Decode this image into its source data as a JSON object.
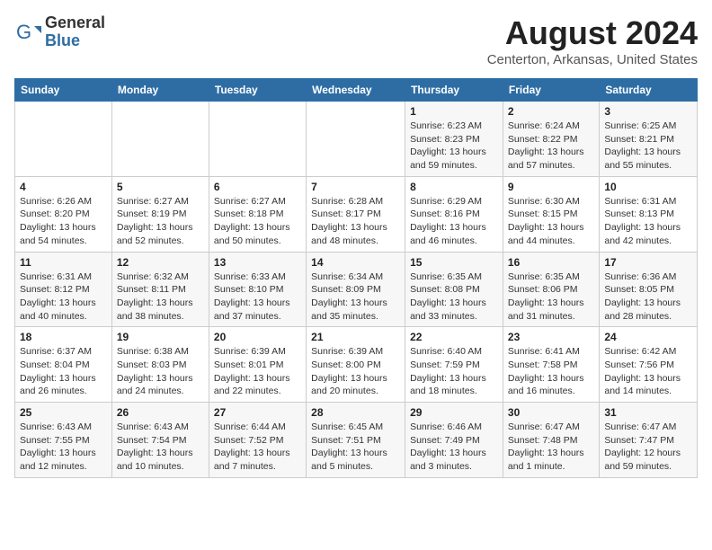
{
  "header": {
    "logo_general": "General",
    "logo_blue": "Blue",
    "title": "August 2024",
    "subtitle": "Centerton, Arkansas, United States"
  },
  "days_of_week": [
    "Sunday",
    "Monday",
    "Tuesday",
    "Wednesday",
    "Thursday",
    "Friday",
    "Saturday"
  ],
  "weeks": [
    [
      {
        "day": "",
        "info": ""
      },
      {
        "day": "",
        "info": ""
      },
      {
        "day": "",
        "info": ""
      },
      {
        "day": "",
        "info": ""
      },
      {
        "day": "1",
        "info": "Sunrise: 6:23 AM\nSunset: 8:23 PM\nDaylight: 13 hours\nand 59 minutes."
      },
      {
        "day": "2",
        "info": "Sunrise: 6:24 AM\nSunset: 8:22 PM\nDaylight: 13 hours\nand 57 minutes."
      },
      {
        "day": "3",
        "info": "Sunrise: 6:25 AM\nSunset: 8:21 PM\nDaylight: 13 hours\nand 55 minutes."
      }
    ],
    [
      {
        "day": "4",
        "info": "Sunrise: 6:26 AM\nSunset: 8:20 PM\nDaylight: 13 hours\nand 54 minutes."
      },
      {
        "day": "5",
        "info": "Sunrise: 6:27 AM\nSunset: 8:19 PM\nDaylight: 13 hours\nand 52 minutes."
      },
      {
        "day": "6",
        "info": "Sunrise: 6:27 AM\nSunset: 8:18 PM\nDaylight: 13 hours\nand 50 minutes."
      },
      {
        "day": "7",
        "info": "Sunrise: 6:28 AM\nSunset: 8:17 PM\nDaylight: 13 hours\nand 48 minutes."
      },
      {
        "day": "8",
        "info": "Sunrise: 6:29 AM\nSunset: 8:16 PM\nDaylight: 13 hours\nand 46 minutes."
      },
      {
        "day": "9",
        "info": "Sunrise: 6:30 AM\nSunset: 8:15 PM\nDaylight: 13 hours\nand 44 minutes."
      },
      {
        "day": "10",
        "info": "Sunrise: 6:31 AM\nSunset: 8:13 PM\nDaylight: 13 hours\nand 42 minutes."
      }
    ],
    [
      {
        "day": "11",
        "info": "Sunrise: 6:31 AM\nSunset: 8:12 PM\nDaylight: 13 hours\nand 40 minutes."
      },
      {
        "day": "12",
        "info": "Sunrise: 6:32 AM\nSunset: 8:11 PM\nDaylight: 13 hours\nand 38 minutes."
      },
      {
        "day": "13",
        "info": "Sunrise: 6:33 AM\nSunset: 8:10 PM\nDaylight: 13 hours\nand 37 minutes."
      },
      {
        "day": "14",
        "info": "Sunrise: 6:34 AM\nSunset: 8:09 PM\nDaylight: 13 hours\nand 35 minutes."
      },
      {
        "day": "15",
        "info": "Sunrise: 6:35 AM\nSunset: 8:08 PM\nDaylight: 13 hours\nand 33 minutes."
      },
      {
        "day": "16",
        "info": "Sunrise: 6:35 AM\nSunset: 8:06 PM\nDaylight: 13 hours\nand 31 minutes."
      },
      {
        "day": "17",
        "info": "Sunrise: 6:36 AM\nSunset: 8:05 PM\nDaylight: 13 hours\nand 28 minutes."
      }
    ],
    [
      {
        "day": "18",
        "info": "Sunrise: 6:37 AM\nSunset: 8:04 PM\nDaylight: 13 hours\nand 26 minutes."
      },
      {
        "day": "19",
        "info": "Sunrise: 6:38 AM\nSunset: 8:03 PM\nDaylight: 13 hours\nand 24 minutes."
      },
      {
        "day": "20",
        "info": "Sunrise: 6:39 AM\nSunset: 8:01 PM\nDaylight: 13 hours\nand 22 minutes."
      },
      {
        "day": "21",
        "info": "Sunrise: 6:39 AM\nSunset: 8:00 PM\nDaylight: 13 hours\nand 20 minutes."
      },
      {
        "day": "22",
        "info": "Sunrise: 6:40 AM\nSunset: 7:59 PM\nDaylight: 13 hours\nand 18 minutes."
      },
      {
        "day": "23",
        "info": "Sunrise: 6:41 AM\nSunset: 7:58 PM\nDaylight: 13 hours\nand 16 minutes."
      },
      {
        "day": "24",
        "info": "Sunrise: 6:42 AM\nSunset: 7:56 PM\nDaylight: 13 hours\nand 14 minutes."
      }
    ],
    [
      {
        "day": "25",
        "info": "Sunrise: 6:43 AM\nSunset: 7:55 PM\nDaylight: 13 hours\nand 12 minutes."
      },
      {
        "day": "26",
        "info": "Sunrise: 6:43 AM\nSunset: 7:54 PM\nDaylight: 13 hours\nand 10 minutes."
      },
      {
        "day": "27",
        "info": "Sunrise: 6:44 AM\nSunset: 7:52 PM\nDaylight: 13 hours\nand 7 minutes."
      },
      {
        "day": "28",
        "info": "Sunrise: 6:45 AM\nSunset: 7:51 PM\nDaylight: 13 hours\nand 5 minutes."
      },
      {
        "day": "29",
        "info": "Sunrise: 6:46 AM\nSunset: 7:49 PM\nDaylight: 13 hours\nand 3 minutes."
      },
      {
        "day": "30",
        "info": "Sunrise: 6:47 AM\nSunset: 7:48 PM\nDaylight: 13 hours\nand 1 minute."
      },
      {
        "day": "31",
        "info": "Sunrise: 6:47 AM\nSunset: 7:47 PM\nDaylight: 12 hours\nand 59 minutes."
      }
    ]
  ]
}
